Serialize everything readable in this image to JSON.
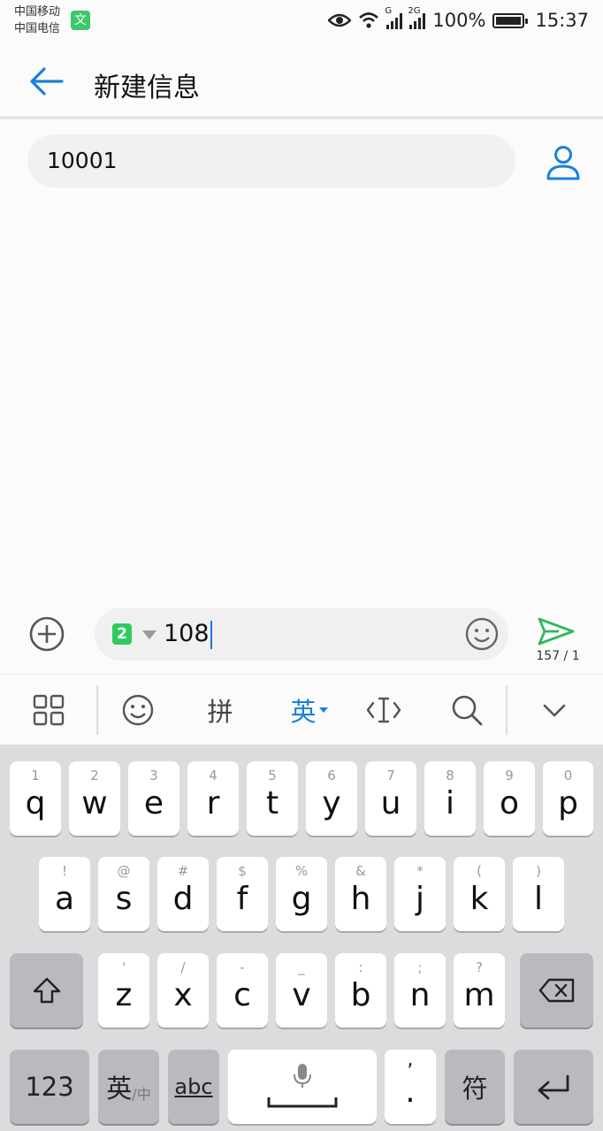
{
  "status": {
    "carrier1": "中国移动",
    "carrier2": "中国电信",
    "vpn_badge": "文",
    "net1": "G",
    "net2": "2G",
    "battery": "100%",
    "time": "15:37"
  },
  "header": {
    "title": "新建信息"
  },
  "recipient": {
    "value": "10001"
  },
  "compose": {
    "sim_slot": "2",
    "text": "108",
    "counter": "157 / 1"
  },
  "toolbar": {
    "pinyin": "拼",
    "english": "英"
  },
  "keyboard": {
    "row1": [
      {
        "main": "q",
        "sub": "1"
      },
      {
        "main": "w",
        "sub": "2"
      },
      {
        "main": "e",
        "sub": "3"
      },
      {
        "main": "r",
        "sub": "4"
      },
      {
        "main": "t",
        "sub": "5"
      },
      {
        "main": "y",
        "sub": "6"
      },
      {
        "main": "u",
        "sub": "7"
      },
      {
        "main": "i",
        "sub": "8"
      },
      {
        "main": "o",
        "sub": "9"
      },
      {
        "main": "p",
        "sub": "0"
      }
    ],
    "row2": [
      {
        "main": "a",
        "sub": "!"
      },
      {
        "main": "s",
        "sub": "@"
      },
      {
        "main": "d",
        "sub": "#"
      },
      {
        "main": "f",
        "sub": "$"
      },
      {
        "main": "g",
        "sub": "%"
      },
      {
        "main": "h",
        "sub": "&"
      },
      {
        "main": "j",
        "sub": "*"
      },
      {
        "main": "k",
        "sub": "("
      },
      {
        "main": "l",
        "sub": ")"
      }
    ],
    "row3": [
      {
        "main": "z",
        "sub": "'"
      },
      {
        "main": "x",
        "sub": "/"
      },
      {
        "main": "c",
        "sub": "-"
      },
      {
        "main": "v",
        "sub": "_"
      },
      {
        "main": "b",
        "sub": ":"
      },
      {
        "main": "n",
        "sub": ";"
      },
      {
        "main": "m",
        "sub": "?"
      }
    ],
    "num_label": "123",
    "lang_label": "英",
    "lang_sub": "/中",
    "abc_label": "abc",
    "period_main": ".",
    "period_sub": ",",
    "symbol_label": "符"
  },
  "colors": {
    "accent": "#1a7fe0",
    "send": "#2eb85c",
    "sim": "#2ecc60"
  }
}
